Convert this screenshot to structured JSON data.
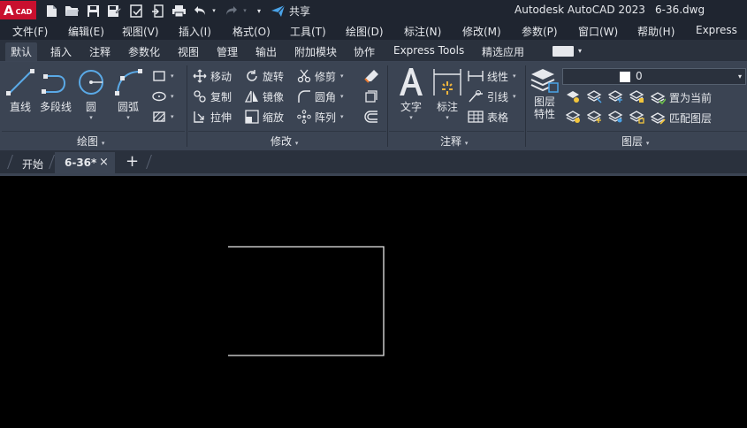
{
  "app": {
    "logo_text": "A",
    "logo_sub": "CAD",
    "title": "Autodesk AutoCAD 2023",
    "file_name": "6-36.dwg",
    "share_label": "共享"
  },
  "quick_access_icons": [
    "new-file-icon",
    "open-folder-icon",
    "save-icon",
    "save-as-icon",
    "publish-icon",
    "import-icon",
    "print-icon",
    "undo-icon",
    "redo-icon",
    "customize-icon",
    "share-icon"
  ],
  "menu": [
    "文件(F)",
    "编辑(E)",
    "视图(V)",
    "插入(I)",
    "格式(O)",
    "工具(T)",
    "绘图(D)",
    "标注(N)",
    "修改(M)",
    "参数(P)",
    "窗口(W)",
    "帮助(H)",
    "Express"
  ],
  "ribbon_tabs": [
    "默认",
    "插入",
    "注释",
    "参数化",
    "视图",
    "管理",
    "输出",
    "附加模块",
    "协作",
    "Express Tools",
    "精选应用"
  ],
  "active_ribbon_tab": "默认",
  "draw_panel": {
    "title": "绘图",
    "buttons": [
      "直线",
      "多段线",
      "圆",
      "圆弧"
    ]
  },
  "modify_panel": {
    "title": "修改",
    "col1": [
      "移动",
      "复制",
      "拉伸"
    ],
    "col2": [
      "旋转",
      "镜像",
      "缩放"
    ],
    "col3": [
      "修剪",
      "圆角",
      "阵列"
    ]
  },
  "annotation_panel": {
    "title": "注释",
    "big": [
      "文字",
      "标注"
    ],
    "small": [
      "线性",
      "引线",
      "表格"
    ]
  },
  "layers_panel": {
    "title": "图层",
    "properties_label_1": "图层",
    "properties_label_2": "特性",
    "current_layer": "0",
    "set_current": "置为当前",
    "match_layer": "匹配图层"
  },
  "document_tabs": {
    "start": "开始",
    "active": "6-36*",
    "close": "×",
    "add": "+"
  },
  "colors": {
    "titlebar": "#1f2530",
    "ribbon": "#3b4453",
    "canvas": "#000000",
    "accent": "#c8102e",
    "drawing_line": "#e6e6e6"
  }
}
